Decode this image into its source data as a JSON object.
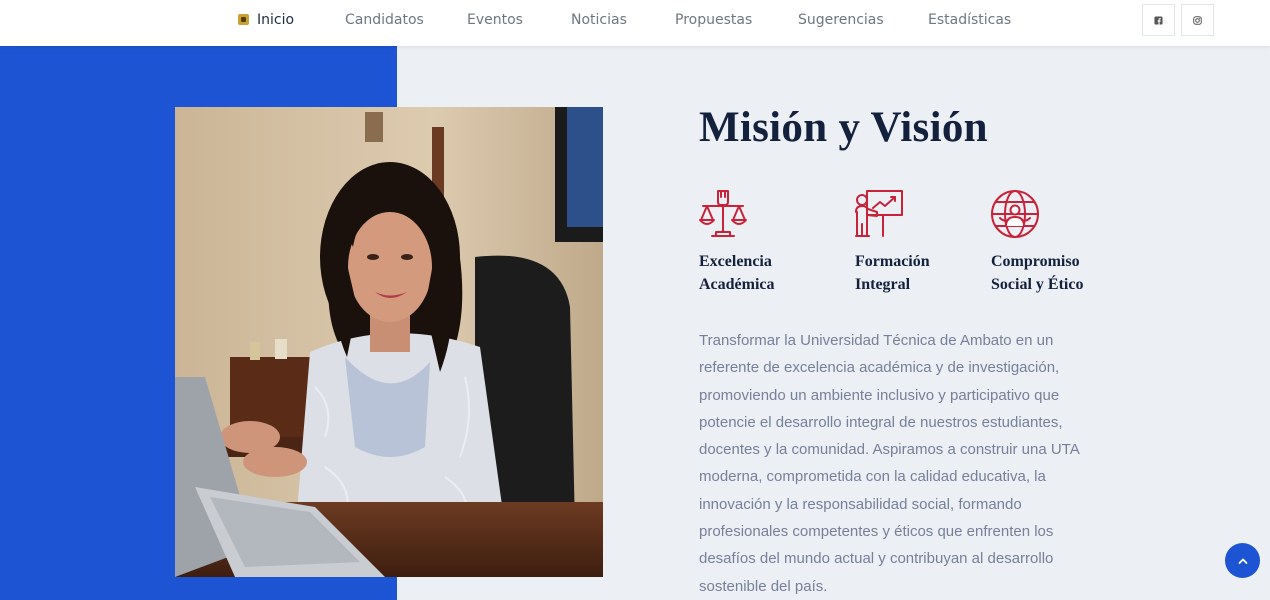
{
  "nav": {
    "items": [
      {
        "label": "Inicio",
        "active": true
      },
      {
        "label": "Candidatos"
      },
      {
        "label": "Eventos"
      },
      {
        "label": "Noticias"
      },
      {
        "label": "Propuestas"
      },
      {
        "label": "Sugerencias"
      },
      {
        "label": "Estadísticas"
      }
    ],
    "social": [
      {
        "icon": "facebook-icon"
      },
      {
        "icon": "instagram-icon"
      }
    ]
  },
  "section": {
    "title": "Misión y Visión",
    "features": [
      {
        "icon": "scales-of-justice-icon",
        "lines": [
          "Excelencia",
          "Académica"
        ]
      },
      {
        "icon": "teacher-presentation-icon",
        "lines": [
          "Formación",
          "Integral"
        ]
      },
      {
        "icon": "globe-people-icon",
        "lines": [
          "Compromiso",
          "Social y Ético"
        ]
      }
    ],
    "description_lines": [
      "Transformar la Universidad Técnica de Ambato en un",
      "referente de excelencia académica y de investigación,",
      "promoviendo un ambiente inclusivo y participativo que",
      "potencie el desarrollo integral de nuestros estudiantes,",
      "docentes y la comunidad. Aspiramos a construir una UTA",
      "moderna, comprometida con la calidad educativa, la",
      "innovación y la responsabilidad social, formando",
      "profesionales competentes y éticos que enfrenten los",
      "desafíos del mundo actual y contribuyan al desarrollo",
      "sostenible del país."
    ]
  },
  "colors": {
    "accent_blue": "#1d54d3",
    "icon_red": "#c8233b",
    "title_navy": "#14213d",
    "body_gray": "#75809a"
  }
}
